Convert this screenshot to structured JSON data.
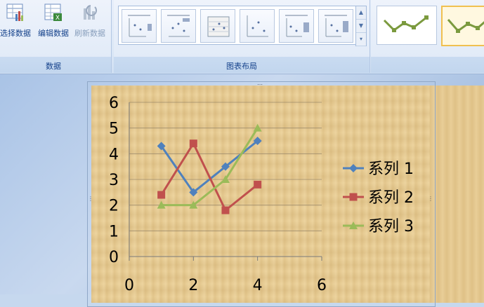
{
  "ribbon": {
    "data_group": {
      "label": "数据",
      "buttons": [
        {
          "label": "选择数据",
          "icon": "select-data-icon",
          "enabled": true
        },
        {
          "label": "编辑数据",
          "icon": "edit-data-icon",
          "enabled": true
        },
        {
          "label": "刷新数据",
          "icon": "refresh-data-icon",
          "enabled": false
        }
      ]
    },
    "layout_group": {
      "label": "图表布局"
    }
  },
  "colors": {
    "series1": "#4f81bd",
    "series2": "#c0504d",
    "series3": "#9bbb59"
  },
  "chart_data": {
    "type": "line",
    "xlim": [
      0,
      6
    ],
    "ylim": [
      0,
      6
    ],
    "x_ticks": [
      "0",
      "2",
      "4",
      "6"
    ],
    "y_ticks": [
      "0",
      "1",
      "2",
      "3",
      "4",
      "5",
      "6"
    ],
    "grid": "horizontal",
    "legend": "right",
    "x": [
      1,
      2,
      3,
      4
    ],
    "series": [
      {
        "name": "系列 1",
        "marker": "diamond",
        "values": [
          4.3,
          2.5,
          3.5,
          4.5
        ]
      },
      {
        "name": "系列 2",
        "marker": "square",
        "values": [
          2.4,
          4.4,
          1.8,
          2.8
        ]
      },
      {
        "name": "系列 3",
        "marker": "triangle",
        "values": [
          2.0,
          2.0,
          3.0,
          5.0
        ]
      }
    ]
  }
}
